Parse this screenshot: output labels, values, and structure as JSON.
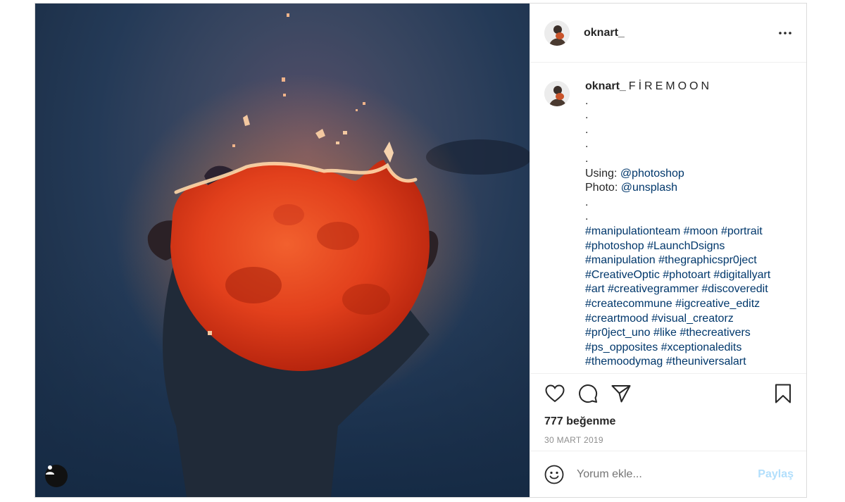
{
  "post": {
    "username": "oknart_",
    "caption": {
      "username": "oknart_",
      "title": "FİREMOON",
      "dots": [
        ".",
        ".",
        ".",
        ".",
        "."
      ],
      "using_label": "Using:",
      "using_handle": "@photoshop",
      "photo_label": "Photo:",
      "photo_handle": "@unsplash",
      "dots2": [
        ".",
        "."
      ],
      "hashtag_lines": [
        "#manipulationteam #moon #portrait",
        "#photoshop #LaunchDsigns",
        "#manipulation #thegraphicspr0ject",
        "#CreativeOptic #photoart #digitallyart",
        "#art #creativegrammer #discoveredit",
        "#createcommune #igcreative_editz",
        "#creartmood #visual_creatorz",
        "#pr0ject_uno #like #thecreativers",
        "#ps_opposites #xceptionaledits",
        "#themoodymag #theuniversalart"
      ]
    },
    "likes": "777 beğenme",
    "date": "30 MART 2019",
    "comment": {
      "placeholder": "Yorum ekle...",
      "share_label": "Paylaş"
    },
    "icons": {
      "more": "more-options-icon",
      "like": "heart-icon",
      "comment": "comment-bubble-icon",
      "share": "paper-plane-icon",
      "save": "bookmark-icon",
      "emoji": "emoji-icon",
      "user_tag": "user-tag-icon"
    },
    "colors": {
      "link": "#00376b",
      "share_disabled": "#b2dffc",
      "moon": "#e8401e"
    }
  }
}
